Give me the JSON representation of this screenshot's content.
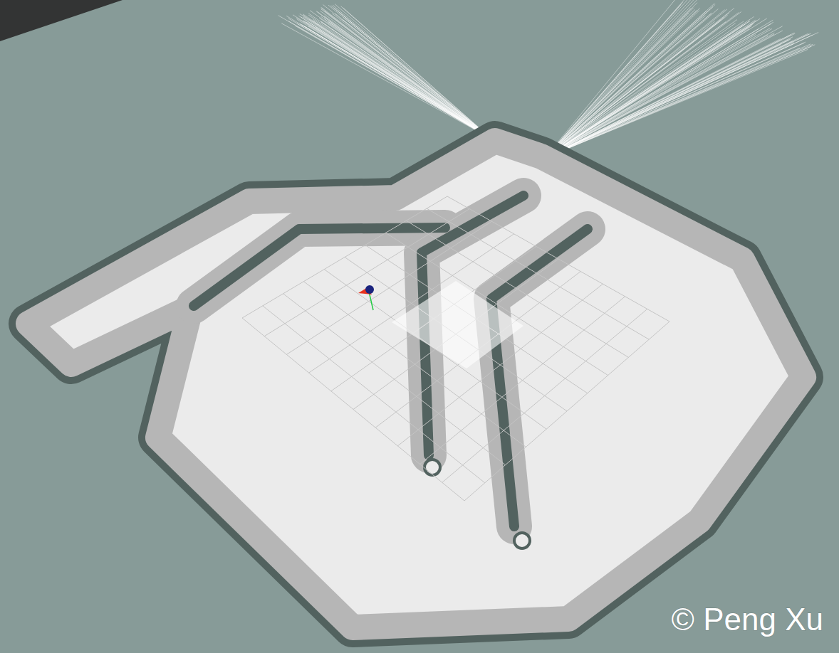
{
  "view": {
    "kind": "occupancy-grid-map"
  },
  "watermark": "© Peng Xu"
}
